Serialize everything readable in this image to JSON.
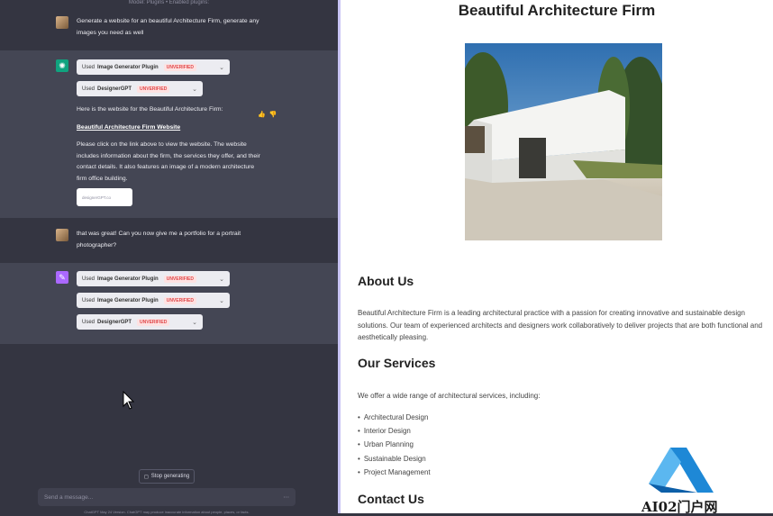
{
  "chat": {
    "topbar": "Model: Plugins  •  Enabled plugins:",
    "user_msg_1": "Generate a website for an beautiful Architecture Firm, generate any images you need as well",
    "plugin_used_prefix": "Used",
    "plugin_image_generator": "Image Generator Plugin",
    "plugin_designergpt": "DesignerGPT",
    "unverified": "UNVERIFIED",
    "bot_intro": "Here is the website for the Beautiful Architecture Firm:",
    "bot_link": "Beautiful Architecture Firm Website",
    "bot_body": "Please click on the link above to view the website. The website includes information about the firm, the services they offer, and their contact details. It also features an image of a modern architecture firm office building.",
    "thumb_label": "designerGPT.co",
    "user_msg_2": "that was great! Can you now give me a portfolio for a portrait photographer?",
    "stop_button": "Stop generating",
    "input_placeholder": "Send a message...",
    "send_icon": "send-icon",
    "footer": "ChatGPT May 24 Version. ChatGPT may produce inaccurate information about people, places, or facts."
  },
  "website": {
    "title": "Beautiful Architecture Firm",
    "about_heading": "About Us",
    "about_text": "Beautiful Architecture Firm is a leading architectural practice with a passion for creating innovative and sustainable design solutions. Our team of experienced architects and designers work collaboratively to deliver projects that are both functional and aesthetically pleasing.",
    "services_heading": "Our Services",
    "services_intro": "We offer a wide range of architectural services, including:",
    "services": [
      "Architectural Design",
      "Interior Design",
      "Urban Planning",
      "Sustainable Design",
      "Project Management"
    ],
    "contact_heading": "Contact Us"
  },
  "watermark": {
    "text": "AI02门户网"
  },
  "colors": {
    "sidebar_bg": "#343541",
    "bot_bg": "#444654",
    "gpt_green": "#10a37f",
    "plugin_purple": "#ab68ff",
    "badge_red": "#e0484a"
  }
}
